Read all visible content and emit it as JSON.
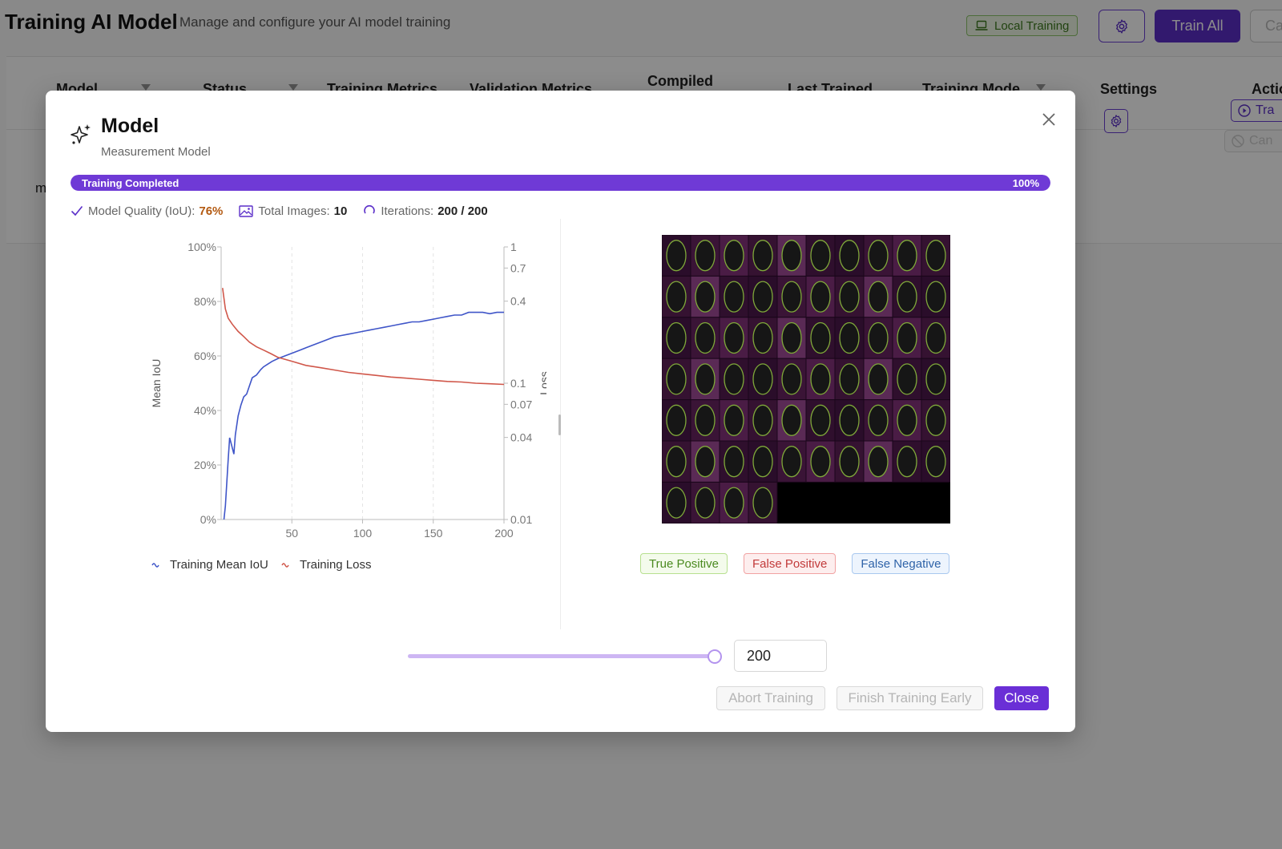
{
  "header": {
    "title": "Training AI Model",
    "subtitle": "Manage and configure your AI model training",
    "local_training_label": "Local Training",
    "train_all_label": "Train All",
    "cancel_partial_label": "Ca"
  },
  "table": {
    "columns": [
      {
        "label": "Model",
        "x": 62
      },
      {
        "label": "Status",
        "x": 245
      },
      {
        "label": "Training Metrics",
        "x": 400
      },
      {
        "label": "Validation Metrics",
        "x": 578
      },
      {
        "label": "Compiled",
        "x": 800
      },
      {
        "label": "Last Trained",
        "x": 975
      },
      {
        "label": "Training Mode",
        "x": 1143
      },
      {
        "label": "Settings",
        "x": 1365
      },
      {
        "label": "Actio",
        "x": 1554
      }
    ],
    "row": {
      "name_partial": "m",
      "train_label": "Tra",
      "cancel_label": "Can"
    }
  },
  "modal": {
    "title": "Model",
    "subtitle": "Measurement Model",
    "progress_label": "Training Completed",
    "progress_percent_text": "100%",
    "progress_value": 1.0,
    "stats": {
      "quality_label": "Model Quality (IoU):",
      "quality_value": "76%",
      "images_label": "Total Images:",
      "images_value": "10",
      "iterations_label": "Iterations:",
      "iterations_value": "200 / 200"
    },
    "legend": {
      "true_positive": "True Positive",
      "false_positive": "False Positive",
      "false_negative": "False Negative"
    },
    "slider_value": 200,
    "iteration_input": "200",
    "buttons": {
      "abort": "Abort Training",
      "finish_early": "Finish Training Early",
      "close": "Close"
    }
  },
  "colors": {
    "accent": "#6a2fd6",
    "iou_line": "#3f55c8",
    "loss_line": "#d0574a"
  },
  "chart_data": {
    "type": "line",
    "x_ticks": [
      50,
      100,
      150,
      200
    ],
    "xlim": [
      0,
      200
    ],
    "ylabel": "Mean IoU",
    "ylim": [
      0,
      100
    ],
    "y_ticks": [
      "0%",
      "20%",
      "40%",
      "60%",
      "80%",
      "100%"
    ],
    "y2label": "Loss",
    "y2_scale": "log",
    "y2lim": [
      0.01,
      1
    ],
    "y2_ticks": [
      "0.01",
      "0.04",
      "0.07",
      "0.1",
      "0.4",
      "0.7",
      "1"
    ],
    "grid": "vertical-dashed",
    "legend_position": "bottom-left",
    "series": [
      {
        "name": "Training Mean IoU",
        "axis": "left",
        "color": "#3f55c8",
        "x": [
          2,
          3,
          5,
          6,
          7,
          9,
          10,
          12,
          14,
          16,
          18,
          20,
          22,
          25,
          28,
          30,
          33,
          36,
          40,
          45,
          50,
          55,
          60,
          65,
          70,
          75,
          80,
          85,
          90,
          95,
          100,
          105,
          110,
          115,
          120,
          125,
          130,
          135,
          140,
          145,
          150,
          155,
          160,
          165,
          170,
          175,
          180,
          185,
          190,
          195,
          200
        ],
        "y": [
          0,
          5,
          22,
          30,
          28,
          24,
          31,
          38,
          42,
          45,
          46,
          49,
          52,
          53,
          55,
          56,
          57,
          58,
          59,
          60,
          61,
          62,
          63,
          64,
          65,
          66,
          67,
          67.5,
          68,
          68.5,
          69,
          69.5,
          70,
          70.5,
          71,
          71.5,
          72,
          72.5,
          72.5,
          73,
          73.5,
          74,
          74.5,
          75,
          75,
          76,
          76,
          76,
          75.5,
          76,
          76
        ]
      },
      {
        "name": "Training Loss",
        "axis": "right",
        "color": "#d0574a",
        "x": [
          1,
          3,
          5,
          8,
          12,
          16,
          20,
          25,
          30,
          35,
          40,
          50,
          60,
          70,
          80,
          90,
          100,
          110,
          120,
          130,
          140,
          150,
          160,
          170,
          180,
          190,
          200
        ],
        "y": [
          0.5,
          0.35,
          0.3,
          0.27,
          0.24,
          0.22,
          0.2,
          0.185,
          0.175,
          0.165,
          0.155,
          0.145,
          0.135,
          0.13,
          0.125,
          0.12,
          0.117,
          0.114,
          0.111,
          0.109,
          0.107,
          0.105,
          0.103,
          0.102,
          0.1,
          0.099,
          0.098
        ]
      }
    ]
  }
}
